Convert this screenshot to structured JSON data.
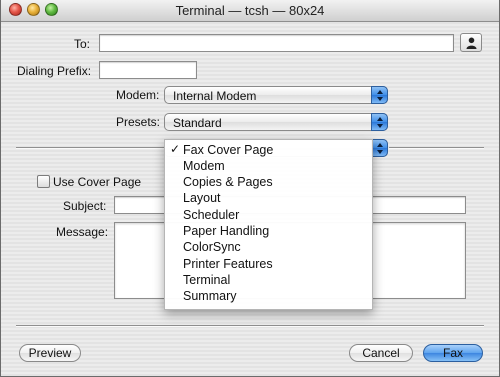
{
  "window": {
    "title": "Terminal — tcsh — 80x24"
  },
  "form": {
    "to_label": "To:",
    "to_value": "",
    "dialing_prefix_label": "Dialing Prefix:",
    "dialing_prefix_value": "",
    "modem_label": "Modem:",
    "modem_value": "Internal Modem",
    "presets_label": "Presets:",
    "presets_value": "Standard"
  },
  "pane_menu": {
    "selected": "Fax Cover Page",
    "check_mark": "✓",
    "items": [
      "Fax Cover Page",
      "Modem",
      "Copies & Pages",
      "Layout",
      "Scheduler",
      "Paper Handling",
      "ColorSync",
      "Printer Features",
      "Terminal",
      "Summary"
    ]
  },
  "cover_page": {
    "use_cover_label": "Use Cover Page",
    "use_cover_checked": false,
    "subject_label": "Subject:",
    "subject_value": "",
    "message_label": "Message:",
    "message_value": ""
  },
  "buttons": {
    "preview": "Preview",
    "cancel": "Cancel",
    "fax": "Fax"
  },
  "icons": {
    "address_book": "person-icon",
    "popup_arrows": "up-down-arrows-icon"
  },
  "colors": {
    "accent": "#3d86e0",
    "window_bg": "#ececec"
  }
}
